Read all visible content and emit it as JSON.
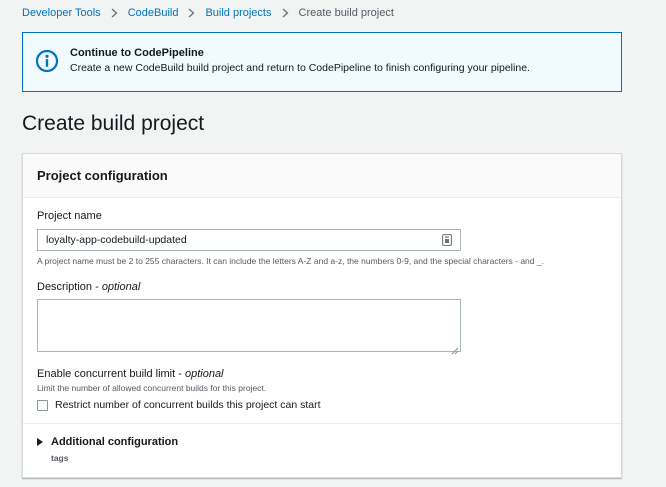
{
  "breadcrumb": {
    "items": [
      {
        "label": "Developer Tools"
      },
      {
        "label": "CodeBuild"
      },
      {
        "label": "Build projects"
      }
    ],
    "current": "Create build project"
  },
  "flash": {
    "icon": "info-icon",
    "title": "Continue to CodePipeline",
    "message": "Create a new CodeBuild build project and return to CodePipeline to finish configuring your pipeline."
  },
  "page": {
    "title": "Create build project"
  },
  "project_configuration": {
    "header": "Project configuration",
    "project_name": {
      "label": "Project name",
      "value": "loyalty-app-codebuild-updated",
      "hint": "A project name must be 2 to 255 characters. It can include the letters A-Z and a-z, the numbers 0-9, and the special characters - and _."
    },
    "description": {
      "label": "Description",
      "optional": "optional",
      "value": ""
    },
    "concurrent": {
      "label": "Enable concurrent build limit",
      "optional": "optional",
      "hint": "Limit the number of allowed concurrent builds for this project.",
      "checkbox_label": "Restrict number of concurrent builds this project can start",
      "checked": false
    },
    "additional": {
      "label": "Additional configuration",
      "sub": "tags"
    }
  },
  "colors": {
    "link": "#0073bb",
    "info_border": "#0073bb",
    "info_bg": "#f1faff",
    "page_bg": "#f2f3f3",
    "text": "#16191f"
  }
}
